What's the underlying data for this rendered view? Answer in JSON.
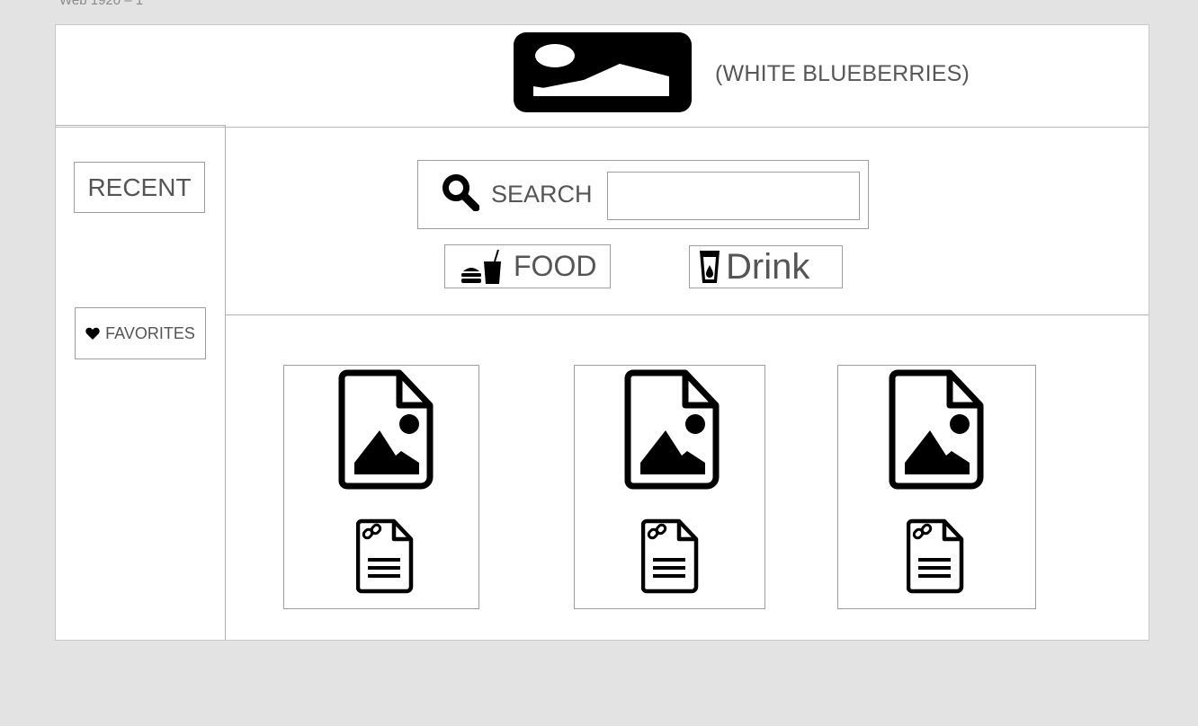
{
  "frame": {
    "label": "Web 1920 – 1"
  },
  "header": {
    "logo_icon": "image-icon",
    "brand_text": "(WHITE BLUEBERRIES)"
  },
  "sidebar": {
    "recent_label": "RECENT",
    "favorites_label": "FAVORITES",
    "favorites_icon": "heart-icon"
  },
  "search": {
    "label": "SEARCH",
    "value": "",
    "placeholder": "",
    "icon": "search-icon"
  },
  "categories": {
    "food_label": "FOOD",
    "food_icon": "fast-food-icon",
    "drink_label": "Drink",
    "drink_icon": "glass-icon"
  },
  "cards": [
    {
      "image_icon": "file-image-icon",
      "doc_icon": "file-link-icon"
    },
    {
      "image_icon": "file-image-icon",
      "doc_icon": "file-link-icon"
    },
    {
      "image_icon": "file-image-icon",
      "doc_icon": "file-link-icon"
    }
  ],
  "colors": {
    "background": "#e3e3e3",
    "panel": "#ffffff",
    "border": "#9e9e9e",
    "text": "#555555",
    "icon": "#000000"
  }
}
